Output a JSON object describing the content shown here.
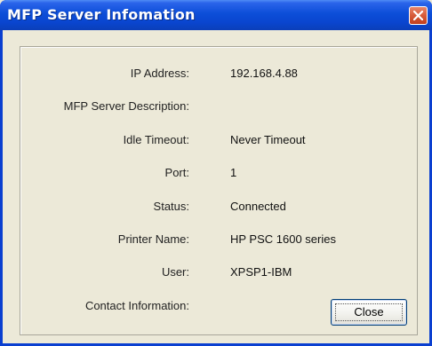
{
  "window": {
    "title": "MFP Server Infomation"
  },
  "fields": [
    {
      "label": "IP Address:",
      "value": "192.168.4.88"
    },
    {
      "label": "MFP Server Description:",
      "value": ""
    },
    {
      "label": "Idle Timeout:",
      "value": "Never Timeout"
    },
    {
      "label": "Port:",
      "value": "1"
    },
    {
      "label": "Status:",
      "value": "Connected"
    },
    {
      "label": "Printer Name:",
      "value": "HP PSC 1600 series"
    },
    {
      "label": "User:",
      "value": "XPSP1-IBM"
    },
    {
      "label": "Contact Information:",
      "value": ""
    }
  ],
  "buttons": {
    "close_label": "Close"
  },
  "icons": {
    "title_close": "close-icon"
  },
  "colors": {
    "titlebar": "#0a45cf",
    "close_button": "#d65b3a",
    "client_background": "#ece9d8"
  }
}
